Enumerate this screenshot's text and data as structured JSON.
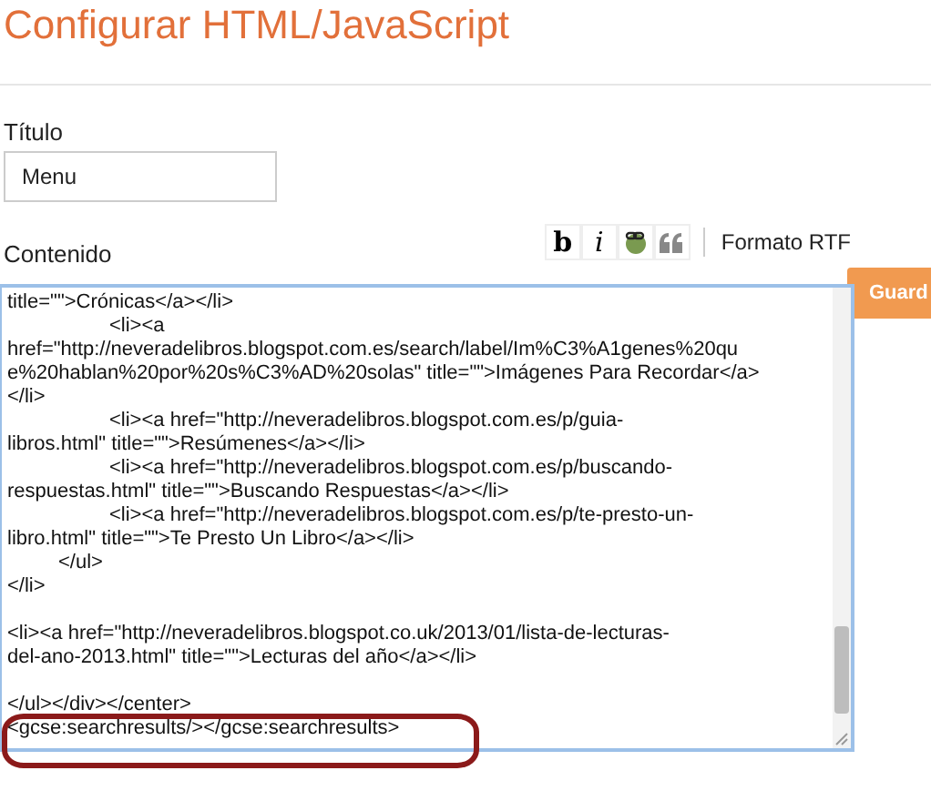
{
  "page_title": "Configurar HTML/JavaScript",
  "title_field": {
    "label": "Título",
    "value": "Menu"
  },
  "content_field": {
    "label": "Contenido",
    "toolbar": [
      {
        "kind": "bold",
        "label": "b"
      },
      {
        "kind": "italic",
        "label": "i"
      },
      {
        "kind": "link"
      },
      {
        "kind": "quote"
      }
    ],
    "rich_text_link": "Formato RTF",
    "lines": [
      {
        "kind": "code",
        "text": "title=\"\">Crónicas</a></li>",
        "circled": false
      },
      {
        "kind": "code",
        "text": "\t\t<li><a",
        "circled": false
      },
      {
        "kind": "code",
        "text": "href=\"http://neveradelibros.blogspot.com.es/search/label/Im%C3%A1genes%20qu",
        "circled": false
      },
      {
        "kind": "code",
        "text": "e%20hablan%20por%20s%C3%AD%20solas\" title=\"\">Imágenes Para Recordar</a>",
        "circled": false
      },
      {
        "kind": "code",
        "text": "</li>",
        "circled": false
      },
      {
        "kind": "code",
        "text": "\t\t<li><a href=\"http://neveradelibros.blogspot.com.es/p/guia-",
        "circled": false
      },
      {
        "kind": "code",
        "text": "libros.html\" title=\"\">Resúmenes</a></li>",
        "circled": false
      },
      {
        "kind": "code",
        "text": "\t\t<li><a href=\"http://neveradelibros.blogspot.com.es/p/buscando-",
        "circled": false
      },
      {
        "kind": "code",
        "text": "respuestas.html\" title=\"\">Buscando Respuestas</a></li>",
        "circled": false
      },
      {
        "kind": "code",
        "text": "\t\t<li><a href=\"http://neveradelibros.blogspot.com.es/p/te-presto-un-",
        "circled": false
      },
      {
        "kind": "code",
        "text": "libro.html\" title=\"\">Te Presto Un Libro</a></li>",
        "circled": false
      },
      {
        "kind": "code",
        "text": "\t</ul>",
        "circled": false
      },
      {
        "kind": "code",
        "text": "</li>",
        "circled": false
      },
      {
        "kind": "blank"
      },
      {
        "kind": "code",
        "text": "<li><a href=\"http://neveradelibros.blogspot.co.uk/2013/01/lista-de-lecturas-",
        "circled": false
      },
      {
        "kind": "code",
        "text": "del-ano-2013.html\" title=\"\">Lecturas del año</a></li>",
        "circled": false
      },
      {
        "kind": "blank"
      },
      {
        "kind": "code",
        "text": "</ul></div></center>",
        "circled": false
      },
      {
        "kind": "code",
        "text": "<gcse:searchresults/></gcse:searchresults>",
        "circled": true
      }
    ]
  },
  "save_button": "Guard"
}
